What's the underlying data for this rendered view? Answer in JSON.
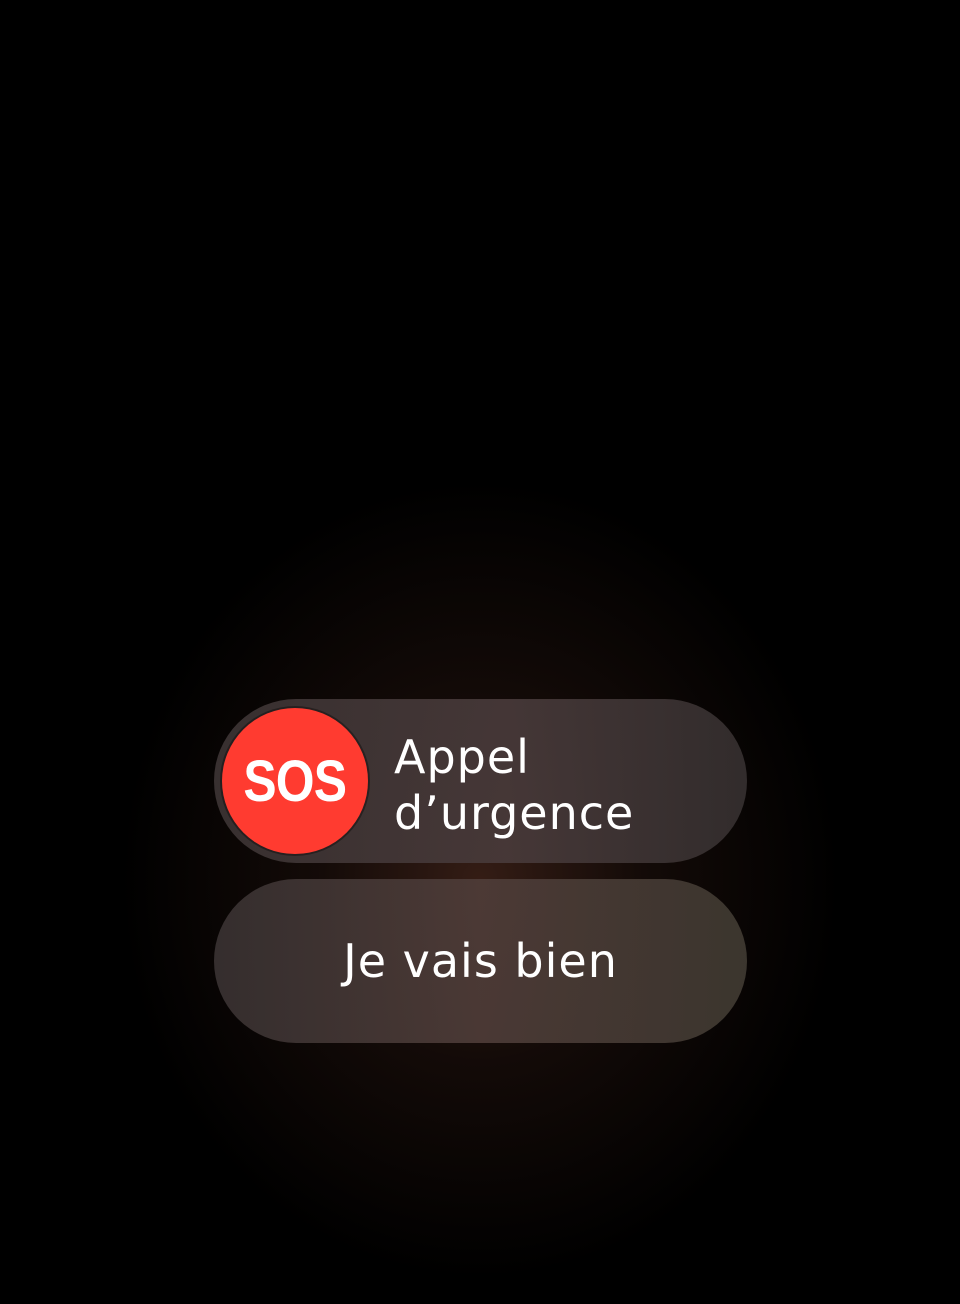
{
  "emergency_slider": {
    "knob_label": "SOS",
    "label_line1": "Appel",
    "label_line2": "d’urgence",
    "knob_color": "#ff3b30"
  },
  "ok_button": {
    "label": "Je vais bien"
  }
}
